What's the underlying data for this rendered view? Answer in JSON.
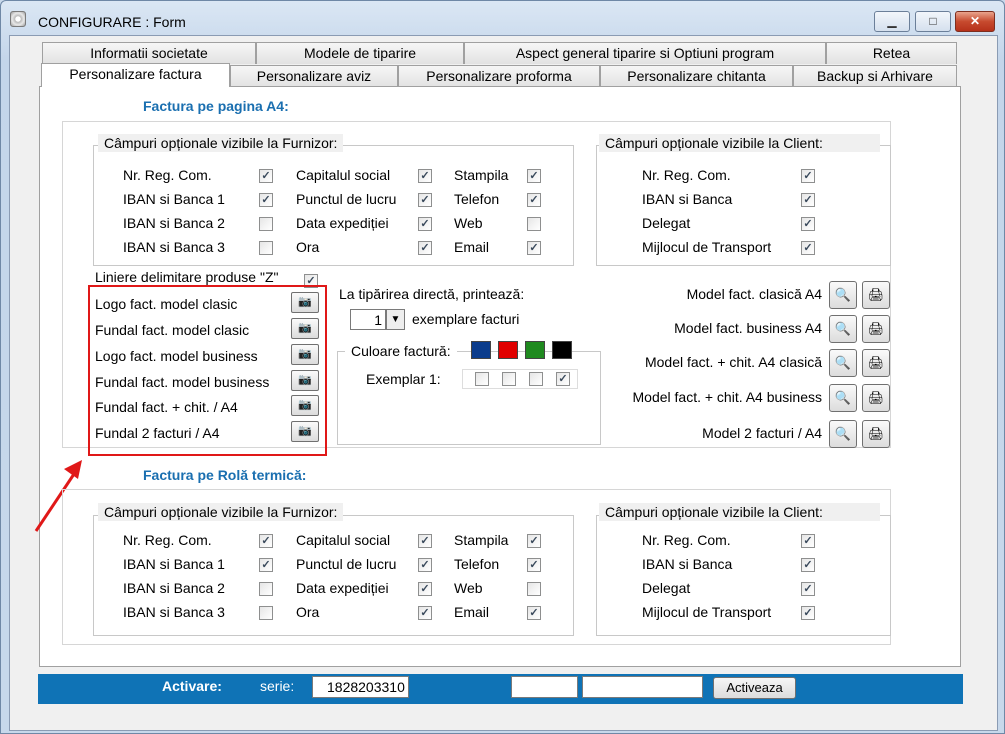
{
  "window": {
    "title": "CONFIGURARE : Form",
    "minimize": "▁",
    "maximize": "□",
    "close": "✕"
  },
  "tabs_row1": [
    {
      "label": "Informatii societate"
    },
    {
      "label": "Modele de tiparire"
    },
    {
      "label": "Aspect general tiparire si Optiuni program"
    },
    {
      "label": "Retea"
    }
  ],
  "tabs_row2": [
    {
      "label": "Personalizare factura"
    },
    {
      "label": "Personalizare aviz"
    },
    {
      "label": "Personalizare proforma"
    },
    {
      "label": "Personalizare chitanta"
    },
    {
      "label": "Backup si Arhivare"
    }
  ],
  "a4": {
    "title": "Factura pe pagina A4:",
    "furnizor": {
      "caption": "Câmpuri opționale vizibile la Furnizor:",
      "col1": [
        {
          "label": "Nr. Reg. Com.",
          "checked": true
        },
        {
          "label": "IBAN si Banca 1",
          "checked": true
        },
        {
          "label": "IBAN si Banca 2",
          "checked": false
        },
        {
          "label": "IBAN si Banca 3",
          "checked": false
        }
      ],
      "col2": [
        {
          "label": "Capitalul social",
          "checked": true
        },
        {
          "label": "Punctul de lucru",
          "checked": true
        },
        {
          "label": "Data expediției",
          "checked": true
        },
        {
          "label": "Ora",
          "checked": true
        }
      ],
      "col3": [
        {
          "label": "Stampila",
          "checked": true
        },
        {
          "label": "Telefon",
          "checked": true
        },
        {
          "label": "Web",
          "checked": false
        },
        {
          "label": "Email",
          "checked": true
        }
      ]
    },
    "client": {
      "caption": "Câmpuri opționale vizibile la Client:",
      "items": [
        {
          "label": "Nr. Reg. Com.",
          "checked": true
        },
        {
          "label": "IBAN si Banca",
          "checked": true
        },
        {
          "label": "Delegat",
          "checked": true
        },
        {
          "label": "Mijlocul de Transport",
          "checked": true
        }
      ]
    },
    "liniere": {
      "label": "Liniere delimitare produse \"Z\"",
      "checked": true
    },
    "images": [
      {
        "label": "Logo fact. model clasic"
      },
      {
        "label": "Fundal fact. model clasic"
      },
      {
        "label": "Logo fact. model business"
      },
      {
        "label": "Fundal fact. model business"
      },
      {
        "label": "Fundal fact. + chit. / A4"
      },
      {
        "label": "Fundal 2 facturi / A4"
      }
    ],
    "print": {
      "label": "La tipărirea directă, printează:",
      "copies": "1",
      "copies_suffix": "exemplare facturi",
      "color_caption": "Culoare factură:",
      "colors": [
        "#0b3c8c",
        "#e00000",
        "#1f8a1f",
        "#000000"
      ],
      "exemplar_label": "Exemplar 1:",
      "exemplar_checks": [
        false,
        false,
        false,
        true
      ]
    },
    "models": [
      {
        "label": "Model fact. clasică A4"
      },
      {
        "label": "Model fact. business A4"
      },
      {
        "label": "Model fact. + chit. A4 clasică"
      },
      {
        "label": "Model fact. + chit. A4 business"
      },
      {
        "label": "Model 2 facturi / A4"
      }
    ]
  },
  "rola": {
    "title": "Factura pe Rolă termică:",
    "furnizor": {
      "caption": "Câmpuri opționale vizibile la Furnizor:",
      "col1": [
        {
          "label": "Nr. Reg. Com.",
          "checked": true
        },
        {
          "label": "IBAN si Banca 1",
          "checked": true
        },
        {
          "label": "IBAN si Banca 2",
          "checked": false
        },
        {
          "label": "IBAN si Banca 3",
          "checked": false
        }
      ],
      "col2": [
        {
          "label": "Capitalul social",
          "checked": true
        },
        {
          "label": "Punctul de lucru",
          "checked": true
        },
        {
          "label": "Data expediției",
          "checked": true
        },
        {
          "label": "Ora",
          "checked": true
        }
      ],
      "col3": [
        {
          "label": "Stampila",
          "checked": true
        },
        {
          "label": "Telefon",
          "checked": true
        },
        {
          "label": "Web",
          "checked": false
        },
        {
          "label": "Email",
          "checked": true
        }
      ]
    },
    "client": {
      "caption": "Câmpuri opționale vizibile la Client:",
      "items": [
        {
          "label": "Nr. Reg. Com.",
          "checked": true
        },
        {
          "label": "IBAN si Banca",
          "checked": true
        },
        {
          "label": "Delegat",
          "checked": true
        },
        {
          "label": "Mijlocul de Transport",
          "checked": true
        }
      ]
    }
  },
  "activation": {
    "label": "Activare:",
    "serie_label": "serie:",
    "serie_value": "1828203310",
    "field2": "",
    "field3": "",
    "button": "Activeaza"
  },
  "icons": {
    "image": "camera-icon",
    "preview": "print-preview-icon",
    "print": "printer-icon"
  },
  "annotation": {
    "highlight_color": "#e01818"
  }
}
